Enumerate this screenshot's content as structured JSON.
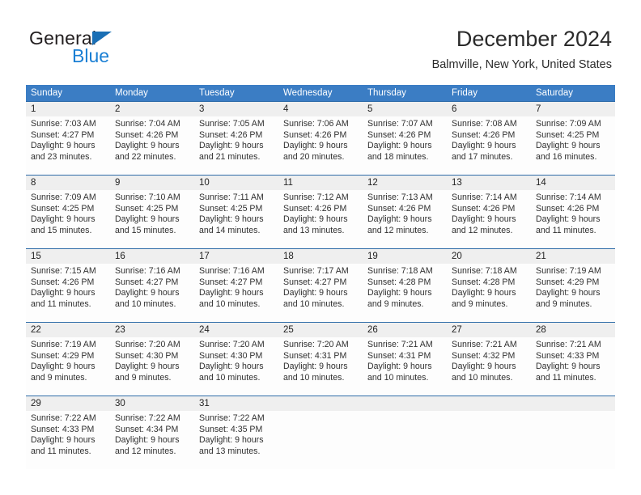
{
  "brand": {
    "name_part1": "General",
    "name_part2": "Blue",
    "triangle_icon": "triangle-icon",
    "color_dark": "#231f20",
    "color_blue": "#1a7fd4"
  },
  "header": {
    "title": "December 2024",
    "subtitle": "Balmville, New York, United States"
  },
  "theme": {
    "header_row_bg": "#3b7dc4",
    "row_separator": "#2f6ca8",
    "daynum_bg": "#efefef",
    "text": "#303030"
  },
  "weekdays": [
    "Sunday",
    "Monday",
    "Tuesday",
    "Wednesday",
    "Thursday",
    "Friday",
    "Saturday"
  ],
  "weeks": [
    [
      {
        "day": "1",
        "sunrise": "Sunrise: 7:03 AM",
        "sunset": "Sunset: 4:27 PM",
        "daylight1": "Daylight: 9 hours",
        "daylight2": "and 23 minutes."
      },
      {
        "day": "2",
        "sunrise": "Sunrise: 7:04 AM",
        "sunset": "Sunset: 4:26 PM",
        "daylight1": "Daylight: 9 hours",
        "daylight2": "and 22 minutes."
      },
      {
        "day": "3",
        "sunrise": "Sunrise: 7:05 AM",
        "sunset": "Sunset: 4:26 PM",
        "daylight1": "Daylight: 9 hours",
        "daylight2": "and 21 minutes."
      },
      {
        "day": "4",
        "sunrise": "Sunrise: 7:06 AM",
        "sunset": "Sunset: 4:26 PM",
        "daylight1": "Daylight: 9 hours",
        "daylight2": "and 20 minutes."
      },
      {
        "day": "5",
        "sunrise": "Sunrise: 7:07 AM",
        "sunset": "Sunset: 4:26 PM",
        "daylight1": "Daylight: 9 hours",
        "daylight2": "and 18 minutes."
      },
      {
        "day": "6",
        "sunrise": "Sunrise: 7:08 AM",
        "sunset": "Sunset: 4:26 PM",
        "daylight1": "Daylight: 9 hours",
        "daylight2": "and 17 minutes."
      },
      {
        "day": "7",
        "sunrise": "Sunrise: 7:09 AM",
        "sunset": "Sunset: 4:25 PM",
        "daylight1": "Daylight: 9 hours",
        "daylight2": "and 16 minutes."
      }
    ],
    [
      {
        "day": "8",
        "sunrise": "Sunrise: 7:09 AM",
        "sunset": "Sunset: 4:25 PM",
        "daylight1": "Daylight: 9 hours",
        "daylight2": "and 15 minutes."
      },
      {
        "day": "9",
        "sunrise": "Sunrise: 7:10 AM",
        "sunset": "Sunset: 4:25 PM",
        "daylight1": "Daylight: 9 hours",
        "daylight2": "and 15 minutes."
      },
      {
        "day": "10",
        "sunrise": "Sunrise: 7:11 AM",
        "sunset": "Sunset: 4:25 PM",
        "daylight1": "Daylight: 9 hours",
        "daylight2": "and 14 minutes."
      },
      {
        "day": "11",
        "sunrise": "Sunrise: 7:12 AM",
        "sunset": "Sunset: 4:26 PM",
        "daylight1": "Daylight: 9 hours",
        "daylight2": "and 13 minutes."
      },
      {
        "day": "12",
        "sunrise": "Sunrise: 7:13 AM",
        "sunset": "Sunset: 4:26 PM",
        "daylight1": "Daylight: 9 hours",
        "daylight2": "and 12 minutes."
      },
      {
        "day": "13",
        "sunrise": "Sunrise: 7:14 AM",
        "sunset": "Sunset: 4:26 PM",
        "daylight1": "Daylight: 9 hours",
        "daylight2": "and 12 minutes."
      },
      {
        "day": "14",
        "sunrise": "Sunrise: 7:14 AM",
        "sunset": "Sunset: 4:26 PM",
        "daylight1": "Daylight: 9 hours",
        "daylight2": "and 11 minutes."
      }
    ],
    [
      {
        "day": "15",
        "sunrise": "Sunrise: 7:15 AM",
        "sunset": "Sunset: 4:26 PM",
        "daylight1": "Daylight: 9 hours",
        "daylight2": "and 11 minutes."
      },
      {
        "day": "16",
        "sunrise": "Sunrise: 7:16 AM",
        "sunset": "Sunset: 4:27 PM",
        "daylight1": "Daylight: 9 hours",
        "daylight2": "and 10 minutes."
      },
      {
        "day": "17",
        "sunrise": "Sunrise: 7:16 AM",
        "sunset": "Sunset: 4:27 PM",
        "daylight1": "Daylight: 9 hours",
        "daylight2": "and 10 minutes."
      },
      {
        "day": "18",
        "sunrise": "Sunrise: 7:17 AM",
        "sunset": "Sunset: 4:27 PM",
        "daylight1": "Daylight: 9 hours",
        "daylight2": "and 10 minutes."
      },
      {
        "day": "19",
        "sunrise": "Sunrise: 7:18 AM",
        "sunset": "Sunset: 4:28 PM",
        "daylight1": "Daylight: 9 hours",
        "daylight2": "and 9 minutes."
      },
      {
        "day": "20",
        "sunrise": "Sunrise: 7:18 AM",
        "sunset": "Sunset: 4:28 PM",
        "daylight1": "Daylight: 9 hours",
        "daylight2": "and 9 minutes."
      },
      {
        "day": "21",
        "sunrise": "Sunrise: 7:19 AM",
        "sunset": "Sunset: 4:29 PM",
        "daylight1": "Daylight: 9 hours",
        "daylight2": "and 9 minutes."
      }
    ],
    [
      {
        "day": "22",
        "sunrise": "Sunrise: 7:19 AM",
        "sunset": "Sunset: 4:29 PM",
        "daylight1": "Daylight: 9 hours",
        "daylight2": "and 9 minutes."
      },
      {
        "day": "23",
        "sunrise": "Sunrise: 7:20 AM",
        "sunset": "Sunset: 4:30 PM",
        "daylight1": "Daylight: 9 hours",
        "daylight2": "and 9 minutes."
      },
      {
        "day": "24",
        "sunrise": "Sunrise: 7:20 AM",
        "sunset": "Sunset: 4:30 PM",
        "daylight1": "Daylight: 9 hours",
        "daylight2": "and 10 minutes."
      },
      {
        "day": "25",
        "sunrise": "Sunrise: 7:20 AM",
        "sunset": "Sunset: 4:31 PM",
        "daylight1": "Daylight: 9 hours",
        "daylight2": "and 10 minutes."
      },
      {
        "day": "26",
        "sunrise": "Sunrise: 7:21 AM",
        "sunset": "Sunset: 4:31 PM",
        "daylight1": "Daylight: 9 hours",
        "daylight2": "and 10 minutes."
      },
      {
        "day": "27",
        "sunrise": "Sunrise: 7:21 AM",
        "sunset": "Sunset: 4:32 PM",
        "daylight1": "Daylight: 9 hours",
        "daylight2": "and 10 minutes."
      },
      {
        "day": "28",
        "sunrise": "Sunrise: 7:21 AM",
        "sunset": "Sunset: 4:33 PM",
        "daylight1": "Daylight: 9 hours",
        "daylight2": "and 11 minutes."
      }
    ],
    [
      {
        "day": "29",
        "sunrise": "Sunrise: 7:22 AM",
        "sunset": "Sunset: 4:33 PM",
        "daylight1": "Daylight: 9 hours",
        "daylight2": "and 11 minutes."
      },
      {
        "day": "30",
        "sunrise": "Sunrise: 7:22 AM",
        "sunset": "Sunset: 4:34 PM",
        "daylight1": "Daylight: 9 hours",
        "daylight2": "and 12 minutes."
      },
      {
        "day": "31",
        "sunrise": "Sunrise: 7:22 AM",
        "sunset": "Sunset: 4:35 PM",
        "daylight1": "Daylight: 9 hours",
        "daylight2": "and 13 minutes."
      },
      {
        "day": "",
        "sunrise": "",
        "sunset": "",
        "daylight1": "",
        "daylight2": ""
      },
      {
        "day": "",
        "sunrise": "",
        "sunset": "",
        "daylight1": "",
        "daylight2": ""
      },
      {
        "day": "",
        "sunrise": "",
        "sunset": "",
        "daylight1": "",
        "daylight2": ""
      },
      {
        "day": "",
        "sunrise": "",
        "sunset": "",
        "daylight1": "",
        "daylight2": ""
      }
    ]
  ]
}
